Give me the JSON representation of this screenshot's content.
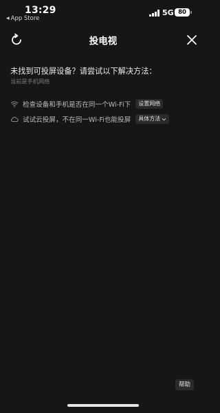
{
  "status_bar": {
    "time": "13:29",
    "back_app": "App Store",
    "network": "5G",
    "battery": "80"
  },
  "nav": {
    "title": "投电视"
  },
  "content": {
    "headline": "未找到可投屏设备？请尝试以下解决方法：",
    "subline": "当前是手机网络",
    "tips": [
      {
        "icon": "wifi-icon",
        "text": "检查设备和手机是否在同一个Wi-Fi下",
        "action": "设置网络"
      },
      {
        "icon": "cloud-icon",
        "text": "试试云投屏，不在同一Wi-Fi也能投屏",
        "action": "具体方法"
      }
    ]
  },
  "footer": {
    "help": "帮助"
  },
  "colors": {
    "background": "#161616",
    "button_bg": "#2a2a2a"
  }
}
